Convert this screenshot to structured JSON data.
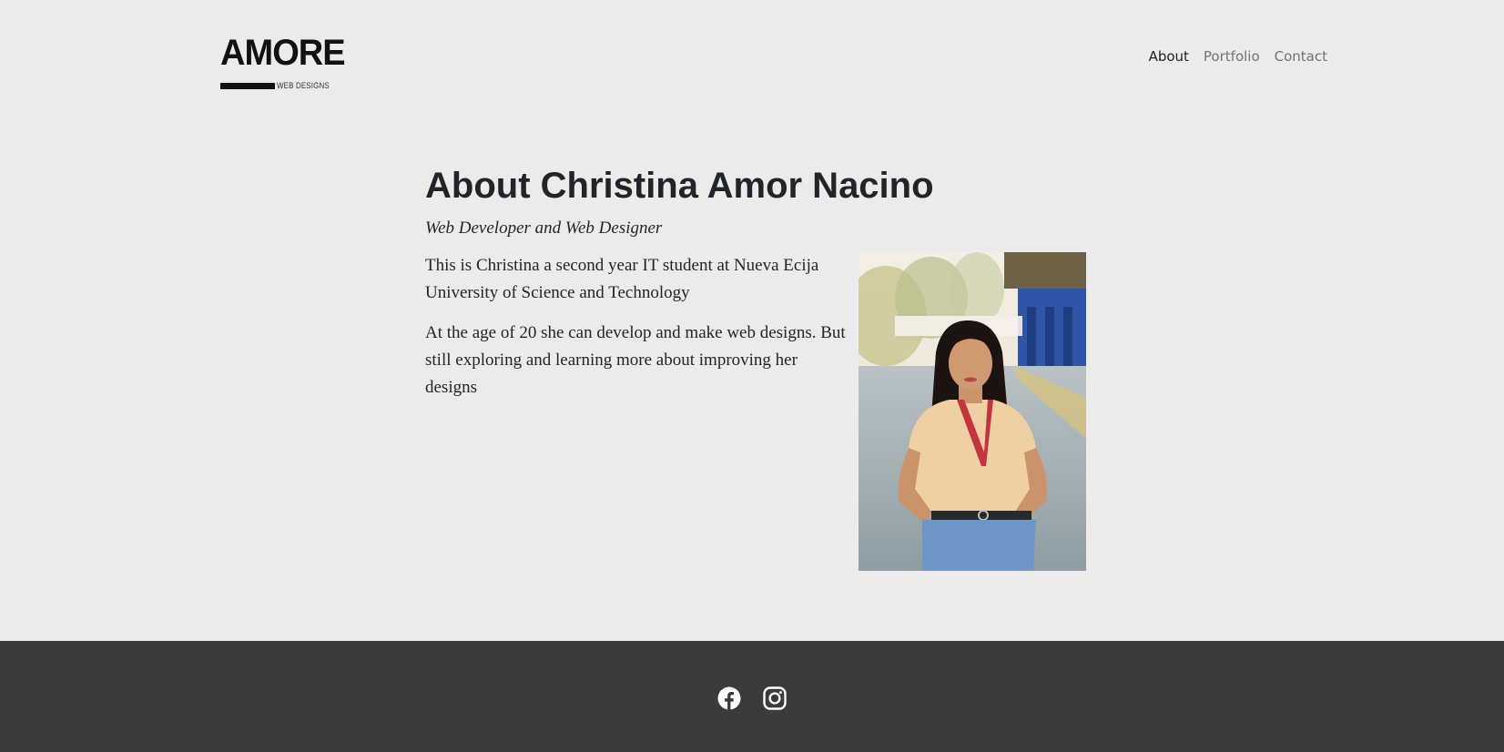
{
  "brand": {
    "logo_word": "AMORE",
    "logo_sub": "WEB DESIGNS"
  },
  "nav": {
    "items": [
      {
        "label": "About"
      },
      {
        "label": "Portfolio"
      },
      {
        "label": "Contact"
      }
    ]
  },
  "main": {
    "title": "About Christina Amor Nacino",
    "subtitle": "Web Developer and Web Designer",
    "paragraphs": [
      "This is Christina a second year IT student at Nueva Ecija University of Science and Technology",
      "At the age of 20 she can develop and make web designs. But still exploring and learning more about improving her designs"
    ]
  },
  "footer": {
    "social": [
      "facebook-icon",
      "instagram-icon"
    ]
  },
  "colors": {
    "background": "#ebebeb",
    "footer": "#3a3a3a",
    "text": "#212529",
    "nav_active": "#222222",
    "nav_inactive": "#737373"
  }
}
